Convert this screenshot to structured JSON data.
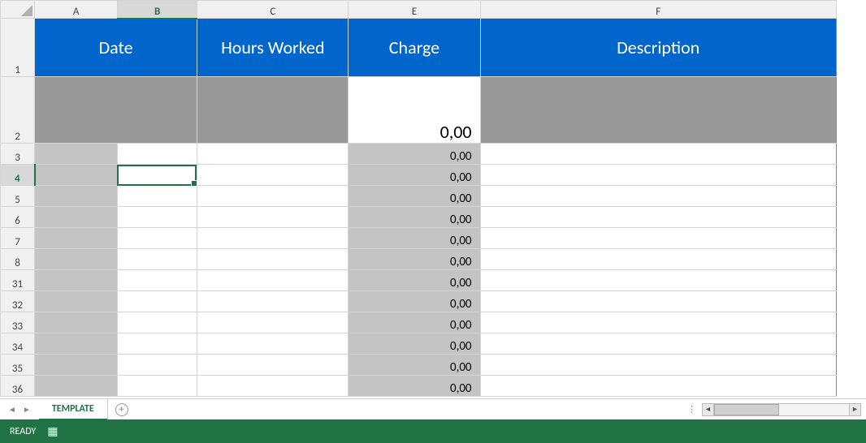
{
  "columns": {
    "A": "A",
    "B": "B",
    "C": "C",
    "E": "E",
    "F": "F"
  },
  "row_labels": [
    "1",
    "2",
    "3",
    "4",
    "5",
    "6",
    "7",
    "8",
    "31",
    "32",
    "33",
    "34",
    "35",
    "36"
  ],
  "active": {
    "col": "B",
    "row": "4",
    "cell": "B4"
  },
  "header": {
    "date": "Date",
    "hours": "Hours Worked",
    "charge": "Charge",
    "description": "Description"
  },
  "summary": {
    "charge": "0,00"
  },
  "rows": [
    {
      "charge": "0,00"
    },
    {
      "charge": "0,00"
    },
    {
      "charge": "0,00"
    },
    {
      "charge": "0,00"
    },
    {
      "charge": "0,00"
    },
    {
      "charge": "0,00"
    },
    {
      "charge": "0,00"
    },
    {
      "charge": "0,00"
    },
    {
      "charge": "0,00"
    },
    {
      "charge": "0,00"
    },
    {
      "charge": "0,00"
    },
    {
      "charge": "0,00"
    }
  ],
  "tabs": {
    "active": "TEMPLATE"
  },
  "status": {
    "text": "READY"
  }
}
